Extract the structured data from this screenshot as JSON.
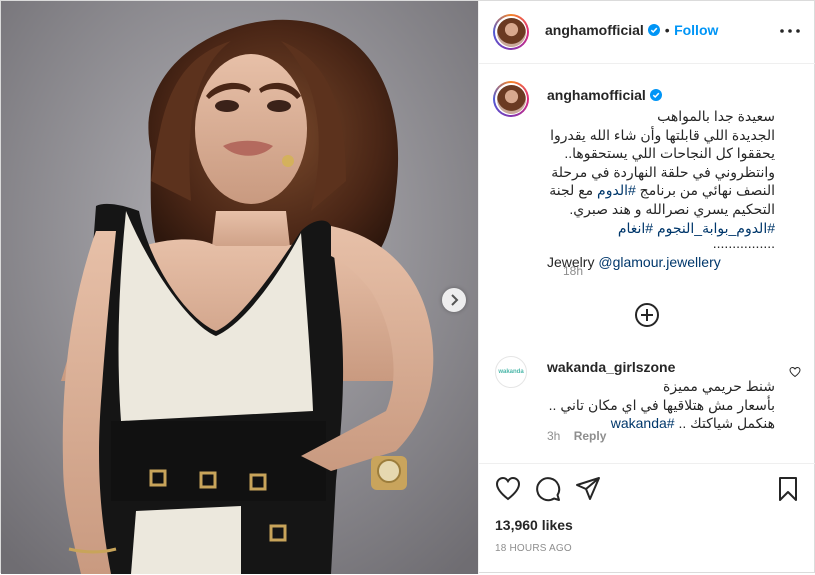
{
  "post": {
    "author": {
      "username": "anghamofficial",
      "verified": true
    },
    "header": {
      "separator": "•",
      "follow_label": "Follow"
    },
    "caption": {
      "lines": [
        "سعيدة جدا بالمواهب",
        "الجديدة اللي قابلتها وأن شاء الله يقدروا",
        "يحققوا كل النجاحات اللي يستحقوها..",
        "وانتظروني في حلقة النهاردة في مرحلة",
        "النصف نهائي من برنامج",
        "#الدوم",
        "مع لجنة",
        "التحكيم يسري نصرالله و هند صبري.",
        "#الدوم_بوابة_النجوم",
        "#انغام",
        "................"
      ],
      "jewelry_label": "Jewelry",
      "jewelry_mention": "@glamour.jewellery",
      "time": "18h"
    },
    "load_more_icon": "plus-circle-icon",
    "comment": {
      "username": "wakanda_girlszone",
      "avatar_text": "wakanda",
      "line1": "شنط حريمي مميزة",
      "line2": "بأسعار مش هتلاقيها في اي مكان تاني ..",
      "line3_text": "هنكمل شياكتك ..",
      "line3_tag": "#wakanda",
      "time": "3h",
      "reply_label": "Reply"
    },
    "actions": {
      "icons": [
        "heart-icon",
        "comment-icon",
        "share-icon",
        "bookmark-icon"
      ],
      "likes": "13,960 likes",
      "date": "18 HOURS AGO"
    }
  },
  "colors": {
    "link_blue": "#0095f6",
    "hashtag": "#00376b",
    "muted": "#8e8e8e",
    "text": "#262626",
    "border": "#dbdbdb"
  }
}
